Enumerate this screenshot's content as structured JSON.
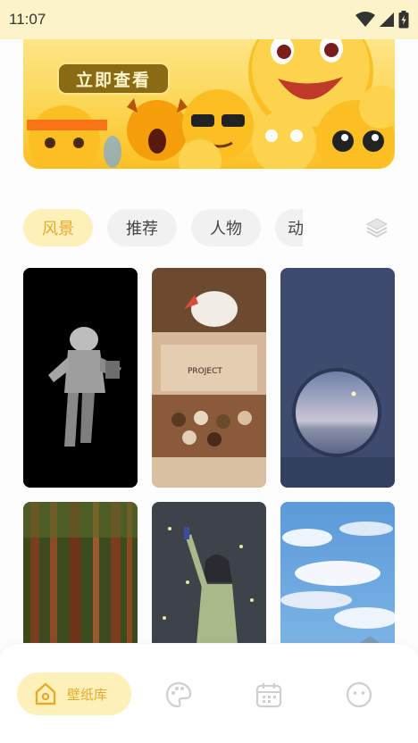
{
  "status": {
    "time": "11:07"
  },
  "banner": {
    "button_label": "立即查看"
  },
  "tabs": [
    {
      "label": "风景",
      "active": true
    },
    {
      "label": "推荐",
      "active": false
    },
    {
      "label": "人物",
      "active": false
    },
    {
      "label": "动",
      "active": false
    }
  ],
  "wallpapers": [
    {
      "name": "astronaut"
    },
    {
      "name": "project-return-snacks"
    },
    {
      "name": "porthole-sea"
    },
    {
      "name": "forest"
    },
    {
      "name": "singer-girl"
    },
    {
      "name": "blue-sky"
    }
  ],
  "bottom_nav": {
    "home_label": "壁纸库"
  },
  "colors": {
    "accent": "#e8a92c",
    "accent_bg": "#fdf0b8",
    "status_bg": "#fdf3c8"
  }
}
